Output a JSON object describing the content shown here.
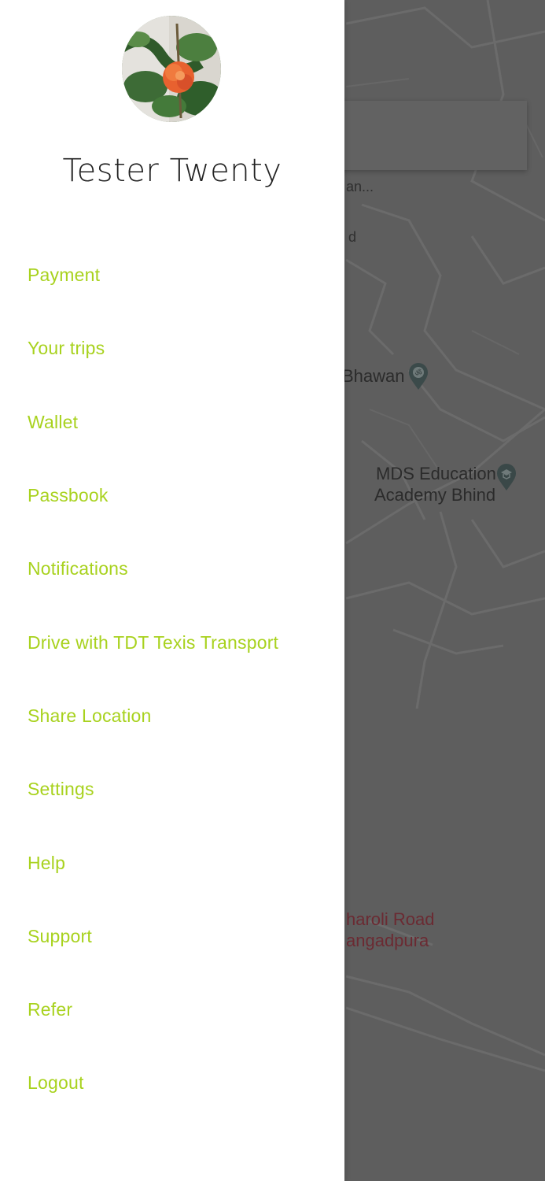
{
  "user": {
    "name": "Tester Twenty",
    "avatar_icon": "profile-photo-flower"
  },
  "menu": {
    "color": "#a8d21e",
    "items": [
      {
        "label": "Payment"
      },
      {
        "label": "Your trips"
      },
      {
        "label": "Wallet"
      },
      {
        "label": "Passbook"
      },
      {
        "label": "Notifications"
      },
      {
        "label": "Drive with TDT Texis Transport"
      },
      {
        "label": "Share Location"
      },
      {
        "label": "Settings"
      },
      {
        "label": "Help"
      },
      {
        "label": "Support"
      },
      {
        "label": "Refer"
      },
      {
        "label": "Logout"
      }
    ]
  },
  "map": {
    "labels": {
      "top_partial_1": "an...",
      "top_partial_2": "d",
      "bhawan": "Bhawan",
      "mds_line1": "MDS Education",
      "mds_line2": "Academy Bhind",
      "road_line1": "haroli Road",
      "road_line2": "angadpura"
    },
    "icons": {
      "temple": "temple-pin-icon",
      "school": "school-pin-icon"
    }
  }
}
